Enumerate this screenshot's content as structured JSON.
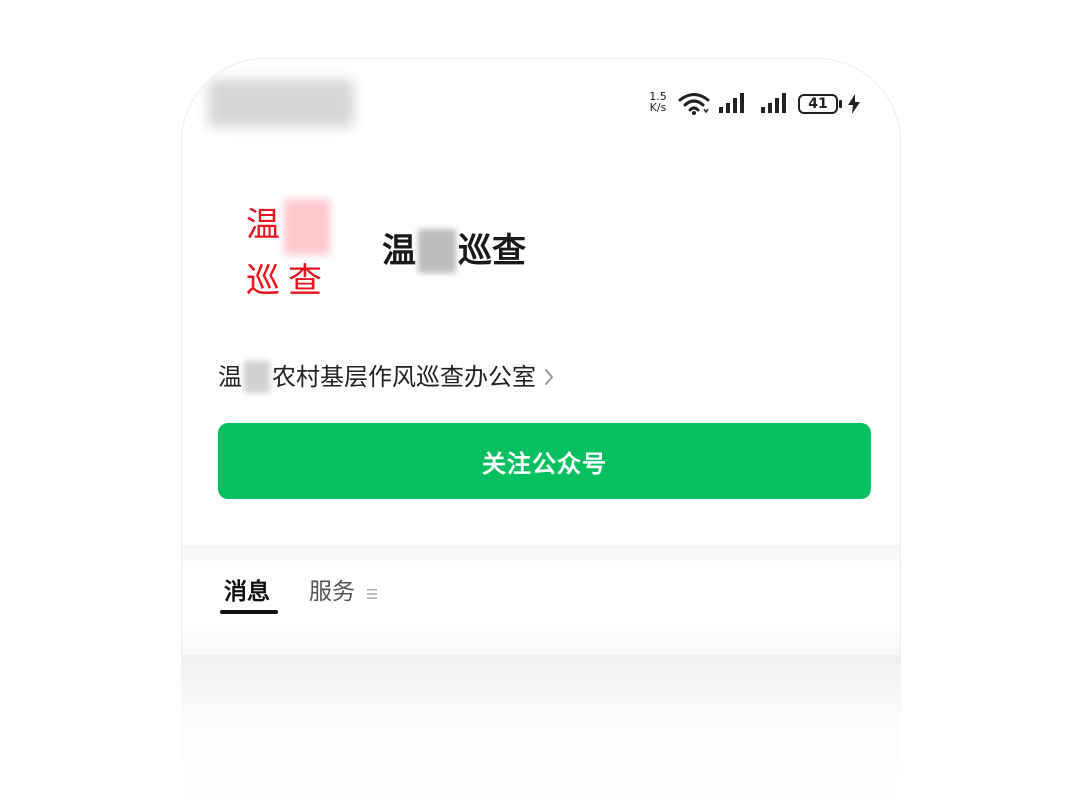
{
  "status_bar": {
    "net_speed_value": "1.5",
    "net_speed_unit": "K/s",
    "battery": "41",
    "icons": [
      "wifi-icon",
      "signal-icon",
      "signal-icon",
      "battery-icon",
      "charging-icon"
    ]
  },
  "account": {
    "logo_chars": [
      "温",
      "巡",
      "查"
    ],
    "title_prefix": "温",
    "title_suffix": "巡查",
    "org_prefix": "温",
    "org_suffix": "农村基层作风巡查办公室",
    "follow_button": "关注公众号"
  },
  "tabs": [
    {
      "label": "消息",
      "active": true
    },
    {
      "label": "服务",
      "active": false
    }
  ],
  "colors": {
    "accent_green": "#07c160",
    "logo_red": "#e8161e"
  }
}
